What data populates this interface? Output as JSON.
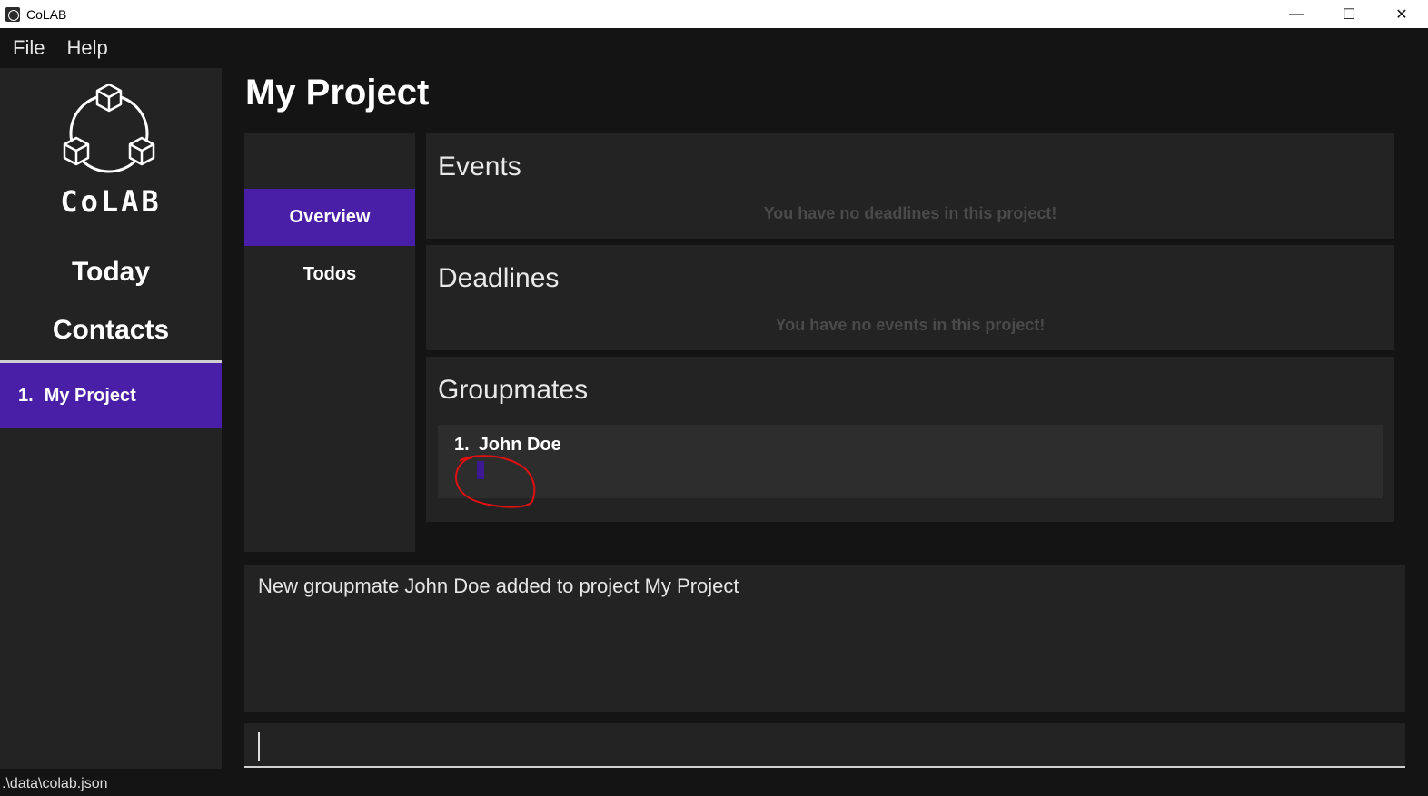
{
  "window": {
    "title": "CoLAB",
    "minimize_glyph": "—",
    "maximize_glyph": "☐",
    "close_glyph": "✕"
  },
  "menu": {
    "items": [
      {
        "label": "File"
      },
      {
        "label": "Help"
      }
    ]
  },
  "sidebar": {
    "logo_text": "CoLAB",
    "nav": [
      {
        "label": "Today"
      },
      {
        "label": "Contacts"
      }
    ],
    "projects": [
      {
        "number": "1.",
        "name": "My Project",
        "selected": true
      }
    ]
  },
  "main": {
    "title": "My Project",
    "tabs": [
      {
        "label": "Overview",
        "selected": true
      },
      {
        "label": "Todos",
        "selected": false
      }
    ],
    "sections": {
      "events": {
        "title": "Events",
        "empty_message": "You have no deadlines in this project!"
      },
      "deadlines": {
        "title": "Deadlines",
        "empty_message": "You have no events in this project!"
      },
      "groupmates": {
        "title": "Groupmates",
        "items": [
          {
            "number": "1.",
            "name": "John Doe"
          }
        ]
      }
    },
    "result_message": "New groupmate John Doe added to project My Project",
    "command": {
      "value": "",
      "placeholder": ""
    }
  },
  "status_bar": {
    "path": ".\\data\\colab.json"
  },
  "colors": {
    "accent": "#4a1fa8",
    "background": "#141414",
    "panel": "#232323",
    "annotation": "#e01010"
  }
}
